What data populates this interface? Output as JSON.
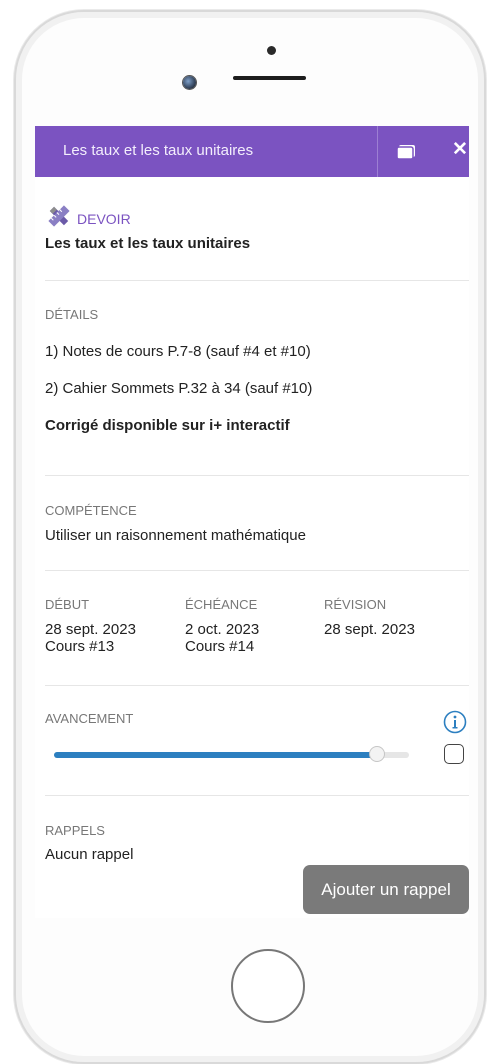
{
  "header": {
    "title": "Les taux et les taux unitaires"
  },
  "assignment": {
    "type_label": "DEVOIR",
    "title": "Les taux et les taux unitaires"
  },
  "details": {
    "label": "DÉTAILS",
    "items": [
      "1) Notes de cours P.7-8 (sauf #4 et #10)",
      "2) Cahier Sommets P.32 à 34 (sauf #10)"
    ],
    "note": "Corrigé disponible sur i+ interactif"
  },
  "competence": {
    "label": "COMPÉTENCE",
    "value": "Utiliser un raisonnement mathématique"
  },
  "dates": [
    {
      "label": "DÉBUT",
      "date": "28 sept. 2023",
      "course": "Cours #13"
    },
    {
      "label": "ÉCHÉANCE",
      "date": "2 oct. 2023",
      "course": "Cours #14"
    },
    {
      "label": "RÉVISION",
      "date": "28 sept. 2023",
      "course": ""
    }
  ],
  "progress": {
    "label": "AVANCEMENT",
    "value_percent": 91,
    "completed": false
  },
  "reminders": {
    "label": "RAPPELS",
    "value": "Aucun rappel",
    "add_button_label": "Ajouter un rappel"
  },
  "colors": {
    "accent": "#7b53c1",
    "progress": "#2c7fc0",
    "info": "#2c7fc0",
    "button": "#7a7a7a"
  },
  "icons": {
    "assignment": "pencil-ruler-icon",
    "window": "window-icon",
    "close": "close-icon",
    "info": "info-icon"
  }
}
